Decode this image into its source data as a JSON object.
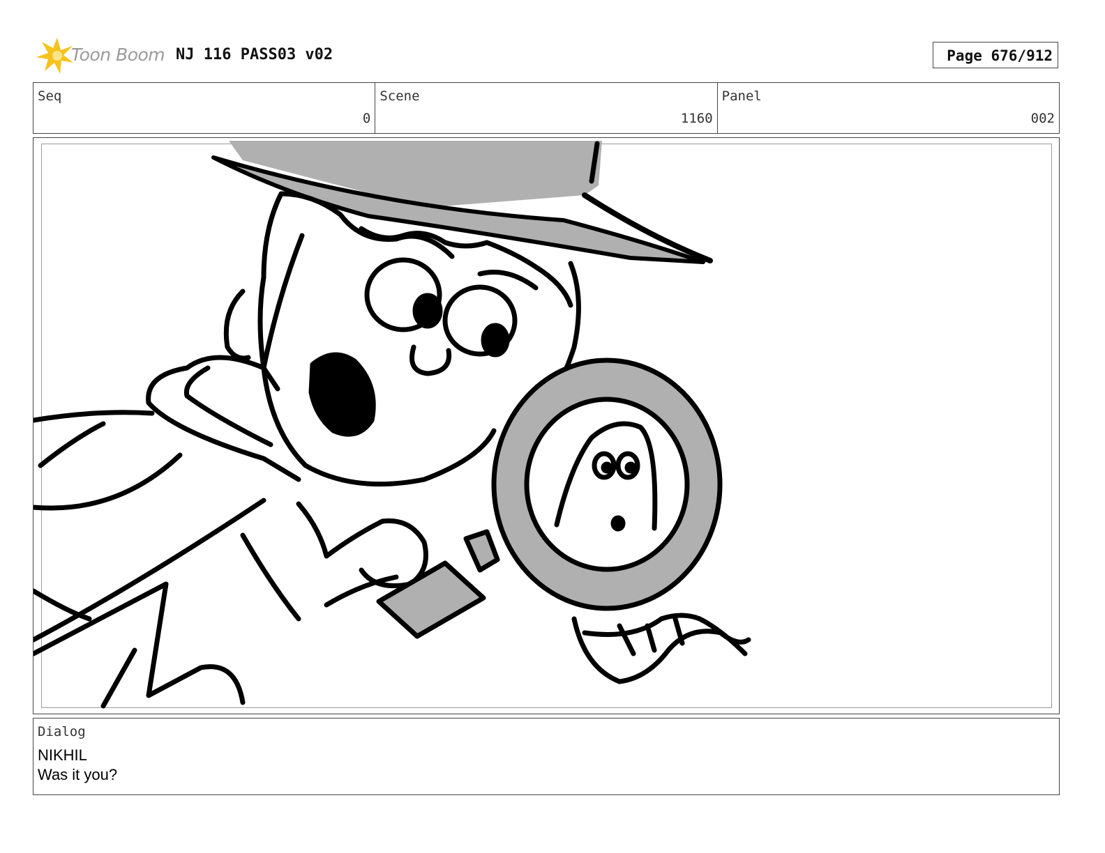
{
  "header": {
    "logo_text": "Toon Boom",
    "project_title": "NJ 116 PASS03 v02",
    "page_label": "Page 676/912"
  },
  "info": {
    "seq": {
      "label": "Seq",
      "value": "0"
    },
    "scene": {
      "label": "Scene",
      "value": "1160"
    },
    "panel": {
      "label": "Panel",
      "value": "002"
    }
  },
  "dialog": {
    "label": "Dialog",
    "speaker": "NIKHIL",
    "line": "Was it you?"
  },
  "colors": {
    "logo_star": "#f7c21b",
    "sketch_fill": "#b0b0b0",
    "line": "#000000"
  }
}
